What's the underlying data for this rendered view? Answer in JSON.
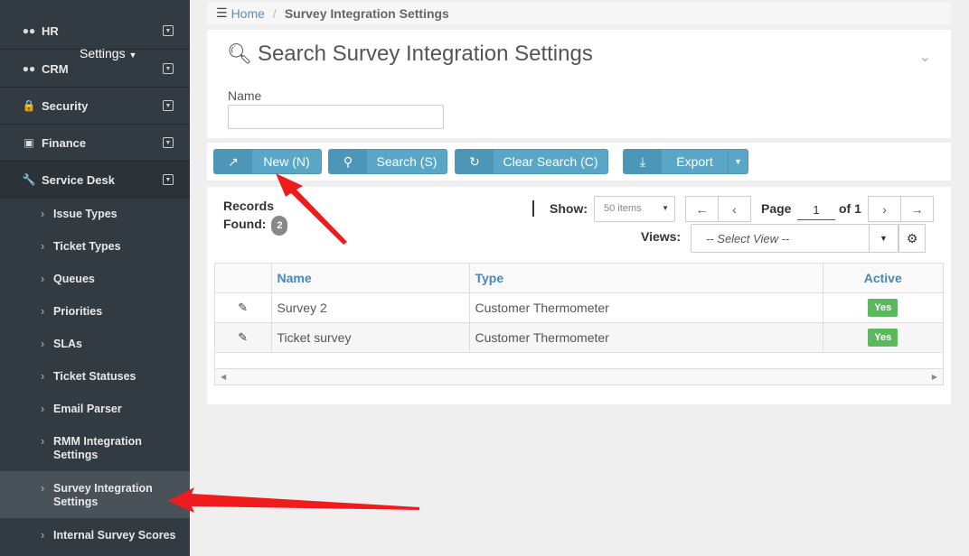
{
  "sidebar": {
    "top_items": [
      {
        "label": "HR",
        "icon": "users-icon"
      },
      {
        "label": "CRM",
        "icon": "users-icon"
      },
      {
        "label": "Security",
        "icon": "lock-icon"
      },
      {
        "label": "Finance",
        "icon": "money-icon"
      },
      {
        "label": "Service Desk",
        "icon": "wrench-icon"
      }
    ],
    "settings_menu": "Settings",
    "sub_items": [
      "Issue Types",
      "Ticket Types",
      "Queues",
      "Priorities",
      "SLAs",
      "Ticket Statuses",
      "Email Parser",
      "RMM Integration Settings",
      "Survey Integration Settings",
      "Internal Survey Scores"
    ]
  },
  "breadcrumb": {
    "home": "Home",
    "separator": "/",
    "current": "Survey Integration Settings"
  },
  "search": {
    "title": "Search Survey Integration Settings",
    "name_label": "Name",
    "name_value": ""
  },
  "toolbar": {
    "new_label": "New (N)",
    "search_label": "Search (S)",
    "clear_label": "Clear Search (C)",
    "export_label": "Export"
  },
  "results": {
    "records_label_1": "Records",
    "records_label_2": "Found:",
    "records_count": "2",
    "show_label": "Show:",
    "items_per_page": "50 items",
    "page_label": "Page",
    "page_number": "1",
    "of_label": "of 1",
    "views_label": "Views:",
    "view_select": "-- Select View --"
  },
  "table": {
    "headers": [
      "",
      "Name",
      "Type",
      "Active"
    ],
    "rows": [
      {
        "name": "Survey 2",
        "type": "Customer Thermometer",
        "active": "Yes"
      },
      {
        "name": "Ticket survey",
        "type": "Customer Thermometer",
        "active": "Yes"
      }
    ]
  },
  "colors": {
    "sidebar_bg": "#333b42",
    "button_bg": "#5aa6c6",
    "active_badge": "#5cb85c",
    "annotation_arrow": "#ee1c1c"
  }
}
